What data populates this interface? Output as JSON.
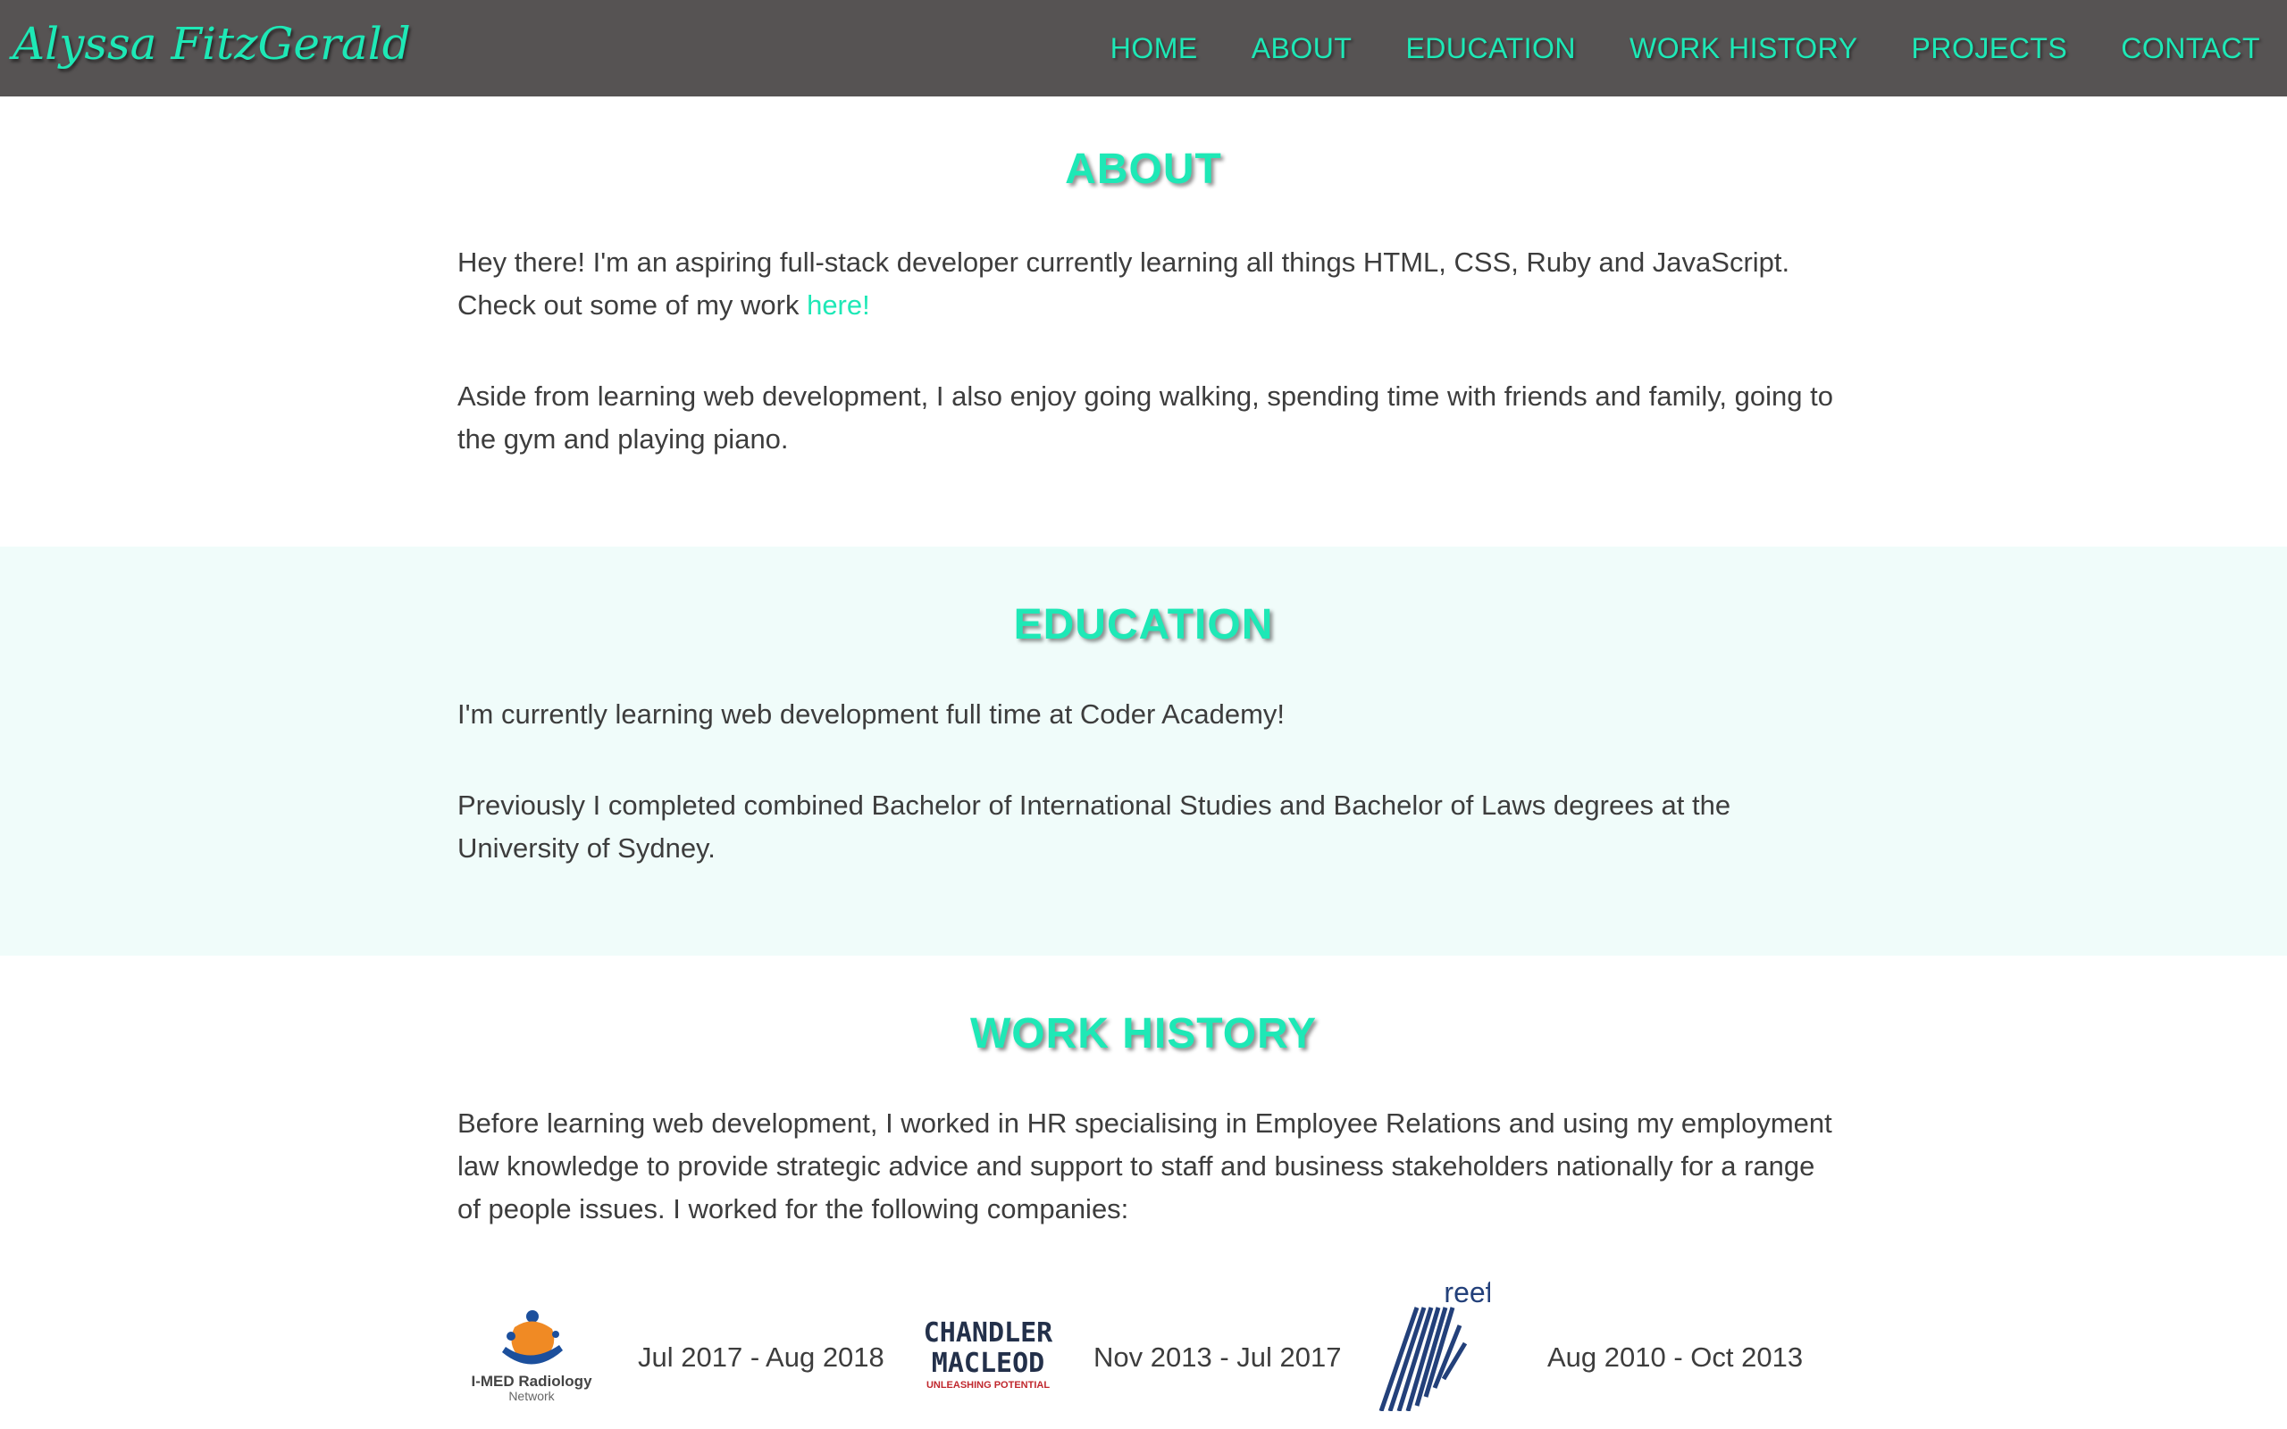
{
  "brand": "Alyssa FitzGerald",
  "nav": [
    "HOME",
    "ABOUT",
    "EDUCATION",
    "WORK HISTORY",
    "PROJECTS",
    "CONTACT"
  ],
  "about": {
    "title": "ABOUT",
    "p1_text": "Hey there! I'm an aspiring full-stack developer currently learning all things HTML, CSS, Ruby and JavaScript. Check out some of my work ",
    "p1_link": "here!",
    "p2": "Aside from learning web development, I also enjoy going walking, spending time with friends and family, going to the gym and playing piano."
  },
  "education": {
    "title": "EDUCATION",
    "p1": "I'm currently learning web development full time at Coder Academy!",
    "p2": "Previously I completed combined Bachelor of International Studies and Bachelor of Laws degrees at the University of Sydney."
  },
  "work": {
    "title": "WORK HISTORY",
    "intro": "Before learning web development, I worked in HR specialising in Employee Relations and using my employment law knowledge to provide strategic advice and support to staff and business stakeholders nationally for a range of people issues. I worked for the following companies:",
    "companies": [
      {
        "logo_text": "I-MED Radiology",
        "logo_sub": "Network",
        "dates": "Jul 2017 - Aug 2018"
      },
      {
        "logo_text_1": "CHANDLER",
        "logo_text_2": "MACLEOD",
        "logo_sub": "UNLEASHING POTENTIAL",
        "dates": "Nov 2013 - Jul 2017"
      },
      {
        "logo_text": "reef",
        "dates": "Aug 2010 - Oct 2013"
      }
    ]
  },
  "colors": {
    "accent": "#1ee8b6",
    "navbar": "#565353",
    "text": "#3d3d3d",
    "alt_section": "#f0fcfa"
  }
}
